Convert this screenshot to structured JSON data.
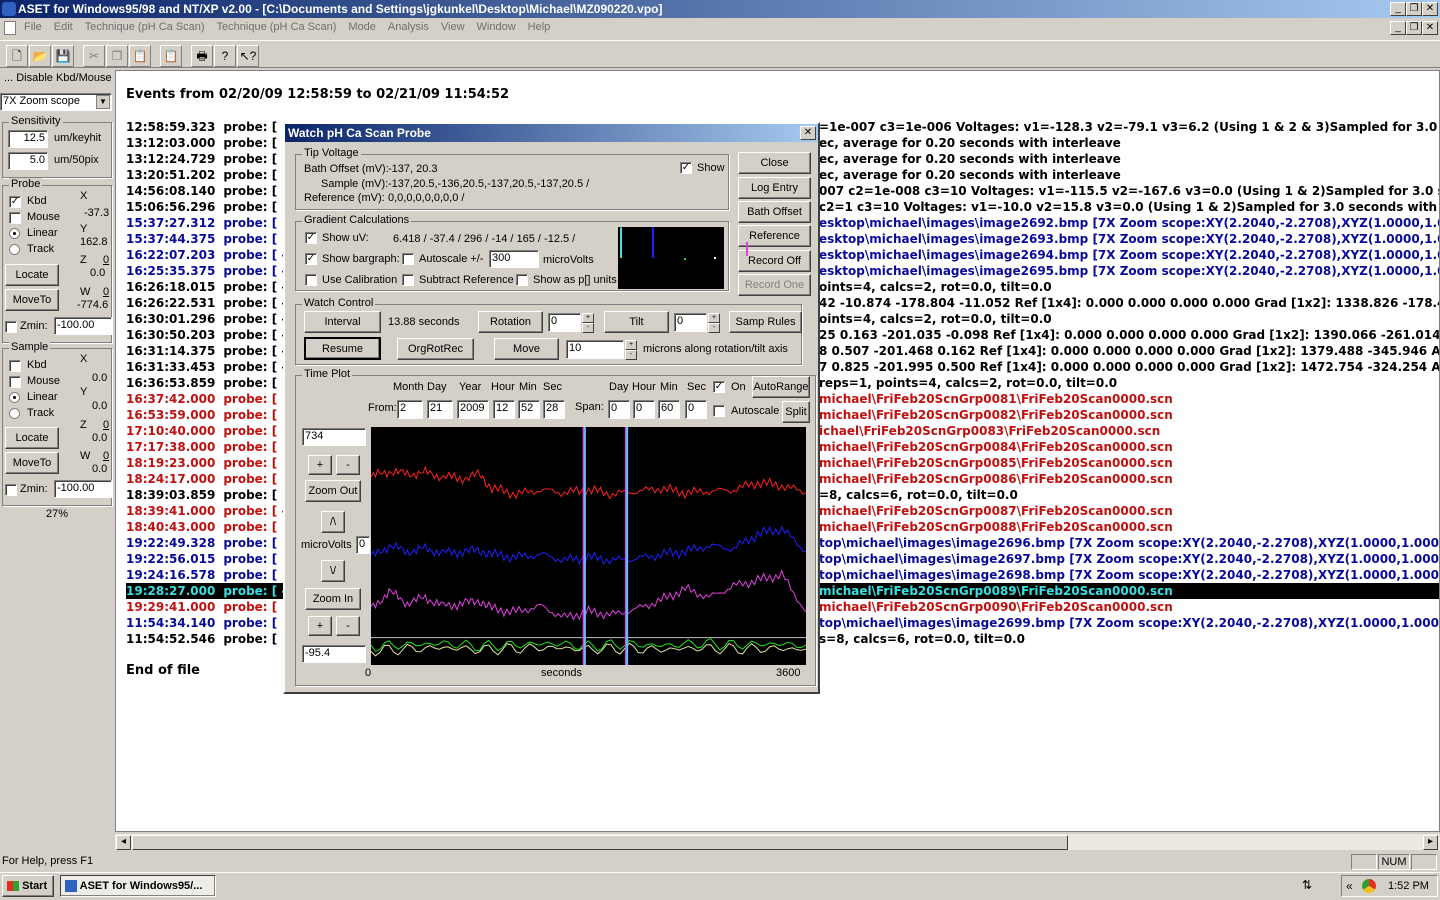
{
  "app": {
    "title": "ASET for Windows95/98 and NT/XP v2.00 - [C:\\Documents and Settings\\jgkunkel\\Desktop\\Michael\\MZ090220.vpo]",
    "menu": [
      "File",
      "Edit",
      "Technique (pH Ca Scan)",
      "Technique (pH Ca Scan)",
      "Mode",
      "Analysis",
      "View",
      "Window",
      "Help"
    ]
  },
  "toolbar": {
    "icons": [
      "new-file-icon",
      "open-folder-icon",
      "save-icon",
      "cut-icon",
      "copy-icon",
      "paste-icon",
      "clipboard-icon",
      "print-icon",
      "help-icon",
      "context-help-icon"
    ]
  },
  "left": {
    "disable_label": "... Disable Kbd/Mouse",
    "zoom_select": "7X Zoom scope",
    "sensitivity": {
      "title": "Sensitivity",
      "keyhit_value": "12.5",
      "keyhit_unit": "um/keyhit",
      "pix_value": "5.0",
      "pix_unit": "um/50pix"
    },
    "probe": {
      "title": "Probe",
      "kbd": "Kbd",
      "mouse": "Mouse",
      "linear": "Linear",
      "track": "Track",
      "x_label": "X",
      "x_value": "-37.3",
      "y_label": "Y",
      "y_value": "162.8",
      "z_label": "Z",
      "z_value": "0.0",
      "z_top": "0",
      "w_label": "W",
      "w_value": "-774.6",
      "w_top": "0",
      "locate": "Locate",
      "moveto": "MoveTo",
      "zmin_label": "Zmin:",
      "zmin_value": "-100.00"
    },
    "sample": {
      "title": "Sample",
      "kbd": "Kbd",
      "mouse": "Mouse",
      "linear": "Linear",
      "track": "Track",
      "x_label": "X",
      "x_value": "0.0",
      "y_label": "Y",
      "y_value": "0.0",
      "z_label": "Z",
      "z_value": "0.0",
      "z_top": "0",
      "w_label": "W",
      "w_value": "0.0",
      "w_top": "0",
      "locate": "Locate",
      "moveto": "MoveTo",
      "zmin_label": "Zmin:",
      "zmin_value": "-100.00"
    },
    "percent": "27%"
  },
  "doc": {
    "header": "Events from 02/20/09 12:58:59 to 02/21/09 11:54:52",
    "events": [
      {
        "time": "12:58:59.323",
        "probe": "probe: [",
        "color": "black"
      },
      {
        "time": "13:12:03.000",
        "probe": "probe: [",
        "color": "black"
      },
      {
        "time": "13:12:24.729",
        "probe": "probe: [",
        "color": "black"
      },
      {
        "time": "13:20:51.202",
        "probe": "probe: [",
        "color": "black"
      },
      {
        "time": "14:56:08.140",
        "probe": "probe: [",
        "color": "black"
      },
      {
        "time": "15:06:56.296",
        "probe": "probe: [",
        "color": "black"
      },
      {
        "time": "15:37:27.312",
        "probe": "probe: [",
        "color": "blue"
      },
      {
        "time": "15:37:44.375",
        "probe": "probe: [",
        "color": "blue"
      },
      {
        "time": "16:22:07.203",
        "probe": "probe: [ -1",
        "color": "blue"
      },
      {
        "time": "16:25:35.375",
        "probe": "probe: [ -1",
        "color": "blue"
      },
      {
        "time": "16:26:18.015",
        "probe": "probe: [ -1",
        "color": "black"
      },
      {
        "time": "16:26:22.531",
        "probe": "probe: [ -1",
        "color": "black"
      },
      {
        "time": "16:30:01.296",
        "probe": "probe: [ -1",
        "color": "black"
      },
      {
        "time": "16:30:50.203",
        "probe": "probe: [ -1",
        "color": "black"
      },
      {
        "time": "16:31:14.375",
        "probe": "probe: [ -1",
        "color": "black"
      },
      {
        "time": "16:31:33.453",
        "probe": "probe: [ -1",
        "color": "black"
      },
      {
        "time": "16:36:53.859",
        "probe": "probe: [",
        "color": "black"
      },
      {
        "time": "16:37:42.000",
        "probe": "probe: [",
        "color": "red"
      },
      {
        "time": "16:53:59.000",
        "probe": "probe: [",
        "color": "red"
      },
      {
        "time": "17:10:40.000",
        "probe": "probe: [",
        "color": "red"
      },
      {
        "time": "17:17:38.000",
        "probe": "probe: [",
        "color": "red"
      },
      {
        "time": "18:19:23.000",
        "probe": "probe: [",
        "color": "red"
      },
      {
        "time": "18:24:17.000",
        "probe": "probe: [",
        "color": "red"
      },
      {
        "time": "18:39:03.859",
        "probe": "probe: [",
        "color": "black"
      },
      {
        "time": "18:39:41.000",
        "probe": "probe: [ -",
        "color": "red"
      },
      {
        "time": "18:40:43.000",
        "probe": "probe: [",
        "color": "red"
      },
      {
        "time": "19:22:49.328",
        "probe": "probe: [",
        "color": "blue"
      },
      {
        "time": "19:22:56.015",
        "probe": "probe: [",
        "color": "blue"
      },
      {
        "time": "19:24:16.578",
        "probe": "probe: [",
        "color": "blue"
      },
      {
        "time": "19:28:27.000",
        "probe": "probe: [ -",
        "color": "hl"
      },
      {
        "time": "19:29:41.000",
        "probe": "probe: [",
        "color": "red"
      },
      {
        "time": "11:54:34.140",
        "probe": "probe: [",
        "color": "blue"
      },
      {
        "time": "11:54:52.546",
        "probe": "probe: [",
        "color": "black"
      }
    ],
    "right_lines": [
      {
        "text": "=1e-007  c3=1e-006  Voltages: v1=-128.3  v2=-79.1  v3=6.2 (Using 1 & 2 & 3)Sampled for 3.0 seco",
        "color": "black"
      },
      {
        "text": "ec, average for 0.20 seconds with interleave",
        "color": "black"
      },
      {
        "text": "ec, average for 0.20 seconds with interleave",
        "color": "black"
      },
      {
        "text": "ec, average for 0.20 seconds with interleave",
        "color": "black"
      },
      {
        "text": "007  c2=1e-008  c3=10  Voltages: v1=-115.5  v2=-167.6  v3=0.0 (Using 1 & 2)Sampled for 3.0 seco",
        "color": "black"
      },
      {
        "text": "  c2=1  c3=10  Voltages: v1=-10.0  v2=15.8  v3=0.0 (Using 1 & 2)Sampled for 3.0 seconds with lo",
        "color": "black"
      },
      {
        "text": "esktop\\michael\\images\\image2692.bmp [7X Zoom scope:XY(2.2040,-2.2708),XYZ(1.0000,1.0000,1.",
        "color": "blue"
      },
      {
        "text": "esktop\\michael\\images\\image2693.bmp [7X Zoom scope:XY(2.2040,-2.2708),XYZ(1.0000,1.0000,1.",
        "color": "blue"
      },
      {
        "text": "esktop\\michael\\images\\image2694.bmp [7X Zoom scope:XY(2.2040,-2.2708),XYZ(1.0000,1.0000,1.",
        "color": "blue"
      },
      {
        "text": "esktop\\michael\\images\\image2695.bmp [7X Zoom scope:XY(2.2040,-2.2708),XYZ(1.0000,1.0000,1.",
        "color": "blue"
      },
      {
        "text": "oints=4, calcs=2, rot=0.0, tilt=0.0",
        "color": "black"
      },
      {
        "text": "42 -10.874 -178.804 -11.052   Ref [1x4]: 0.000 0.000 0.000 0.000 Grad [1x2]: 1338.826 -178.488",
        "color": "black"
      },
      {
        "text": "oints=4, calcs=2, rot=0.0, tilt=0.0",
        "color": "black"
      },
      {
        "text": "25 0.163 -201.035 -0.098   Ref [1x4]: 0.000 0.000 0.000 0.000 Grad [1x2]: 1390.066 -261.014  Avg",
        "color": "black"
      },
      {
        "text": "8 0.507 -201.468 0.162   Ref [1x4]: 0.000 0.000 0.000 0.000 Grad [1x2]: 1379.488 -345.946  AvgC",
        "color": "black"
      },
      {
        "text": "7 0.825 -201.995 0.500   Ref [1x4]: 0.000 0.000 0.000 0.000 Grad [1x2]: 1472.754 -324.254  AvgC",
        "color": "black"
      },
      {
        "text": "reps=1, points=4, calcs=2, rot=0.0, tilt=0.0",
        "color": "black"
      },
      {
        "text": "michael\\FriFeb20ScnGrp0081\\FriFeb20Scan0000.scn",
        "color": "red"
      },
      {
        "text": "michael\\FriFeb20ScnGrp0082\\FriFeb20Scan0000.scn",
        "color": "red"
      },
      {
        "text": "ichael\\FriFeb20ScnGrp0083\\FriFeb20Scan0000.scn",
        "color": "red"
      },
      {
        "text": "michael\\FriFeb20ScnGrp0084\\FriFeb20Scan0000.scn",
        "color": "red"
      },
      {
        "text": "michael\\FriFeb20ScnGrp0085\\FriFeb20Scan0000.scn",
        "color": "red"
      },
      {
        "text": "michael\\FriFeb20ScnGrp0086\\FriFeb20Scan0000.scn",
        "color": "red"
      },
      {
        "text": "=8, calcs=6, rot=0.0, tilt=0.0",
        "color": "black"
      },
      {
        "text": "michael\\FriFeb20ScnGrp0087\\FriFeb20Scan0000.scn",
        "color": "red"
      },
      {
        "text": "michael\\FriFeb20ScnGrp0088\\FriFeb20Scan0000.scn",
        "color": "red"
      },
      {
        "text": "top\\michael\\images\\image2696.bmp [7X Zoom scope:XY(2.2040,-2.2708),XYZ(1.0000,1.0000,1.00",
        "color": "blue"
      },
      {
        "text": "top\\michael\\images\\image2697.bmp [7X Zoom scope:XY(2.2040,-2.2708),XYZ(1.0000,1.0000,1.00",
        "color": "blue"
      },
      {
        "text": "top\\michael\\images\\image2698.bmp [7X Zoom scope:XY(2.2040,-2.2708),XYZ(1.0000,1.0000,1.00",
        "color": "blue"
      },
      {
        "text": "michael\\FriFeb20ScnGrp0089\\FriFeb20Scan0000.scn",
        "color": "hl"
      },
      {
        "text": "michael\\FriFeb20ScnGrp0090\\FriFeb20Scan0000.scn",
        "color": "red"
      },
      {
        "text": "top\\michael\\images\\image2699.bmp [7X Zoom scope:XY(2.2040,-2.2708),XYZ(1.0000,1.0000,1.0",
        "color": "blue"
      },
      {
        "text": "s=8, calcs=6, rot=0.0, tilt=0.0",
        "color": "black"
      }
    ],
    "footer": "End of file"
  },
  "dialog": {
    "title": "Watch pH Ca Scan Probe",
    "tip": {
      "title": "Tip Voltage",
      "bath_label": "Bath Offset (mV):",
      "bath_value": "-137, 20.3",
      "sample_label": "Sample (mV):",
      "sample_value": "-137,20.5,-136,20.5,-137,20.5,-137,20.5 /",
      "ref_label": "Reference (mV):",
      "ref_value": "0,0,0,0,0,0,0,0 /",
      "show": "Show"
    },
    "buttons": {
      "close": "Close",
      "log_entry": "Log Entry",
      "bath_offset": "Bath Offset",
      "reference": "Reference",
      "record_off": "Record Off",
      "record_one": "Record One"
    },
    "grad": {
      "title": "Gradient Calculations",
      "show_uv": "Show uV:",
      "uv_values": "6.418 / -37.4 / 296 / -14 / 165 / -12.5 /",
      "show_bargraph": "Show bargraph:",
      "autoscale": "Autoscale +/-",
      "autoscale_value": "300",
      "microvolts": "microVolts",
      "use_cal": "Use Calibration",
      "subtract_ref": "Subtract Reference",
      "show_p": "Show as p[] units"
    },
    "watch": {
      "title": "Watch Control",
      "interval": "Interval",
      "interval_value": "13.88 seconds",
      "rotation": "Rotation",
      "rotation_value": "0",
      "tilt": "Tilt",
      "tilt_value": "0",
      "samp_rules": "Samp Rules",
      "resume": "Resume",
      "orgrotrec": "OrgRotRec",
      "move": "Move",
      "move_value": "10",
      "move_unit": "microns along rotation/tilt axis"
    },
    "timeplot": {
      "title": "Time Plot",
      "h_month": "Month",
      "h_day": "Day",
      "h_year": "Year",
      "h_hour": "Hour",
      "h_min": "Min",
      "h_sec": "Sec",
      "from_label": "From:",
      "from_month": "2",
      "from_day": "21",
      "from_year": "2009",
      "from_hour": "12",
      "from_min": "52",
      "from_sec": "28",
      "span_label": "Span:",
      "sh_day": "Day",
      "sh_hour": "Hour",
      "sh_min": "Min",
      "sh_sec": "Sec",
      "span_day": "0",
      "span_hour": "0",
      "span_min": "60",
      "span_sec": "0",
      "on_label": "On",
      "autorange": "AutoRange",
      "autoscale": "Autoscale",
      "split": "Split",
      "ymax": "734",
      "ymin": "-95.4",
      "zoom_out": "Zoom Out",
      "zoom_in": "Zoom In",
      "microvolts": "microVolts",
      "mv_offset": "0",
      "plus": "+",
      "minus": "-",
      "up": "/\\",
      "down": "\\/",
      "x_start": "0",
      "x_label": "seconds",
      "x_end": "3600"
    }
  },
  "status": {
    "help": "For Help, press F1",
    "num": "NUM"
  },
  "taskbar": {
    "start": "Start",
    "task": "ASET for Windows95/...",
    "time": "1:52 PM",
    "chevron": "«"
  },
  "chart_data": {
    "type": "line",
    "x_range": [
      0,
      3600
    ],
    "y_range": [
      -95.4,
      734
    ],
    "xlabel": "seconds",
    "ylabel": "microVolts",
    "series": [
      {
        "color": "#ff2020",
        "points": [
          [
            0,
            560
          ],
          [
            150,
            580
          ],
          [
            300,
            570
          ],
          [
            450,
            575
          ],
          [
            600,
            560
          ],
          [
            780,
            555
          ],
          [
            900,
            570
          ],
          [
            1000,
            520
          ],
          [
            1200,
            500
          ],
          [
            1400,
            515
          ],
          [
            1600,
            505
          ],
          [
            1800,
            515
          ],
          [
            2000,
            500
          ],
          [
            2200,
            510
          ],
          [
            2400,
            520
          ],
          [
            2600,
            505
          ],
          [
            2800,
            510
          ],
          [
            3000,
            515
          ],
          [
            3200,
            540
          ],
          [
            3400,
            530
          ],
          [
            3600,
            505
          ]
        ]
      },
      {
        "color": "#2020ff",
        "points": [
          [
            0,
            280
          ],
          [
            150,
            320
          ],
          [
            300,
            300
          ],
          [
            450,
            310
          ],
          [
            600,
            295
          ],
          [
            780,
            300
          ],
          [
            900,
            305
          ],
          [
            1000,
            290
          ],
          [
            1200,
            280
          ],
          [
            1400,
            290
          ],
          [
            1600,
            270
          ],
          [
            1800,
            280
          ],
          [
            2000,
            270
          ],
          [
            2200,
            275
          ],
          [
            2400,
            290
          ],
          [
            2600,
            300
          ],
          [
            2800,
            320
          ],
          [
            3000,
            310
          ],
          [
            3200,
            360
          ],
          [
            3400,
            380
          ],
          [
            3600,
            300
          ]
        ]
      },
      {
        "color": "#e040e0",
        "points": [
          [
            0,
            100
          ],
          [
            150,
            160
          ],
          [
            300,
            120
          ],
          [
            450,
            140
          ],
          [
            600,
            110
          ],
          [
            780,
            120
          ],
          [
            900,
            130
          ],
          [
            1000,
            100
          ],
          [
            1200,
            90
          ],
          [
            1400,
            110
          ],
          [
            1600,
            70
          ],
          [
            1800,
            90
          ],
          [
            2000,
            80
          ],
          [
            2200,
            100
          ],
          [
            2400,
            130
          ],
          [
            2600,
            170
          ],
          [
            2800,
            140
          ],
          [
            3000,
            180
          ],
          [
            3200,
            200
          ],
          [
            3400,
            220
          ],
          [
            3600,
            90
          ]
        ]
      },
      {
        "color": "#20e020",
        "points": [
          [
            0,
            -30
          ],
          [
            300,
            -25
          ],
          [
            600,
            -20
          ],
          [
            900,
            -30
          ],
          [
            1200,
            -25
          ],
          [
            1500,
            -20
          ],
          [
            1800,
            -30
          ],
          [
            2100,
            -22
          ],
          [
            2400,
            -28
          ],
          [
            2700,
            -20
          ],
          [
            3000,
            -25
          ],
          [
            3300,
            -22
          ],
          [
            3600,
            -25
          ]
        ]
      },
      {
        "color": "#e0e0a0",
        "points": [
          [
            0,
            -45
          ],
          [
            300,
            -40
          ],
          [
            600,
            -35
          ],
          [
            900,
            -42
          ],
          [
            1200,
            -38
          ],
          [
            1500,
            -35
          ],
          [
            1800,
            -40
          ],
          [
            2100,
            -38
          ],
          [
            2400,
            -42
          ],
          [
            2700,
            -36
          ],
          [
            3000,
            -40
          ],
          [
            3300,
            -38
          ],
          [
            3600,
            -40
          ]
        ]
      }
    ],
    "spikes": [
      {
        "x": 1760,
        "color": "#e040e0"
      },
      {
        "x": 2110,
        "color": "#e040e0"
      },
      {
        "x": 2120,
        "color": "#60c0ff"
      },
      {
        "x": 1770,
        "color": "#60c0ff"
      }
    ],
    "crosshair_y": 0,
    "bargraph": [
      {
        "color": "#40e0e0",
        "value": 296
      },
      {
        "color": "#2020ff",
        "value": 296
      },
      {
        "color": "#20e020",
        "value": -14
      }
    ]
  }
}
